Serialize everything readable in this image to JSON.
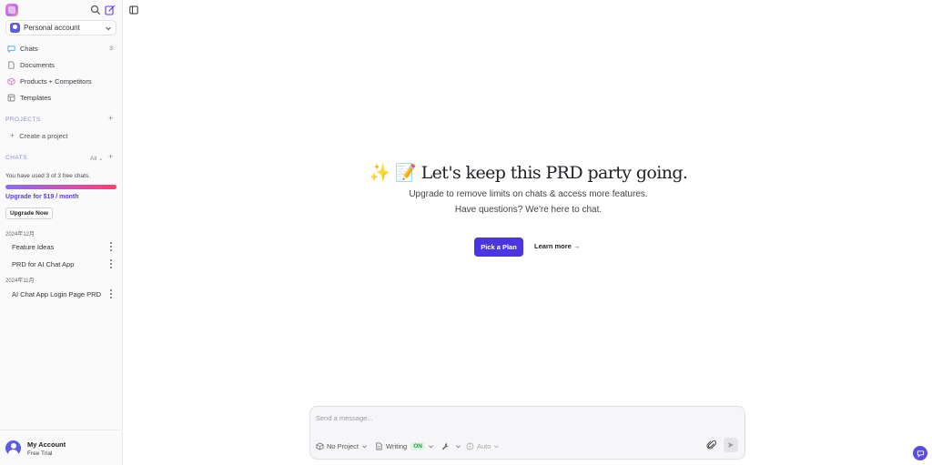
{
  "sidebar": {
    "account_selector": {
      "label": "Personal account"
    },
    "nav": [
      {
        "label": "Chats",
        "icon": "chat-icon",
        "count": "3"
      },
      {
        "label": "Documents",
        "icon": "document-icon",
        "count": ""
      },
      {
        "label": "Products + Competitors",
        "icon": "products-icon",
        "count": ""
      },
      {
        "label": "Templates",
        "icon": "templates-icon",
        "count": ""
      }
    ],
    "projects": {
      "heading": "PROJECTS",
      "create_label": "Create a project"
    },
    "chats": {
      "heading": "CHATS",
      "filter": "All",
      "usage_text": "You have used 3 of 3 free chats.",
      "usage_fraction": 1.0,
      "upgrade_link": "Upgrade for $19 / month",
      "upgrade_button": "Upgrade Now",
      "groups": [
        {
          "date": "2024年12月",
          "items": [
            "Feature Ideas",
            "PRD for AI Chat App"
          ]
        },
        {
          "date": "2024年11月",
          "items": [
            "AI Chat App Login Page PRD"
          ]
        }
      ]
    },
    "account": {
      "name": "My Account",
      "plan": "Free Trial"
    }
  },
  "main": {
    "hero_title": "✨ 📝 Let's keep this PRD party going.",
    "hero_line1": "Upgrade to remove limits on chats & access more features.",
    "hero_line2": "Have questions? We're here to chat.",
    "primary_button": "Pick a Plan",
    "secondary_link": "Learn more →"
  },
  "composer": {
    "placeholder": "Send a message...",
    "project_selector": "No Project",
    "mode_label": "Writing",
    "mode_state": "ON",
    "model_label": "Auto"
  },
  "colors": {
    "accent": "#4b35e0",
    "on_badge_bg": "#dff3e2",
    "on_badge_text": "#2e9a47"
  }
}
